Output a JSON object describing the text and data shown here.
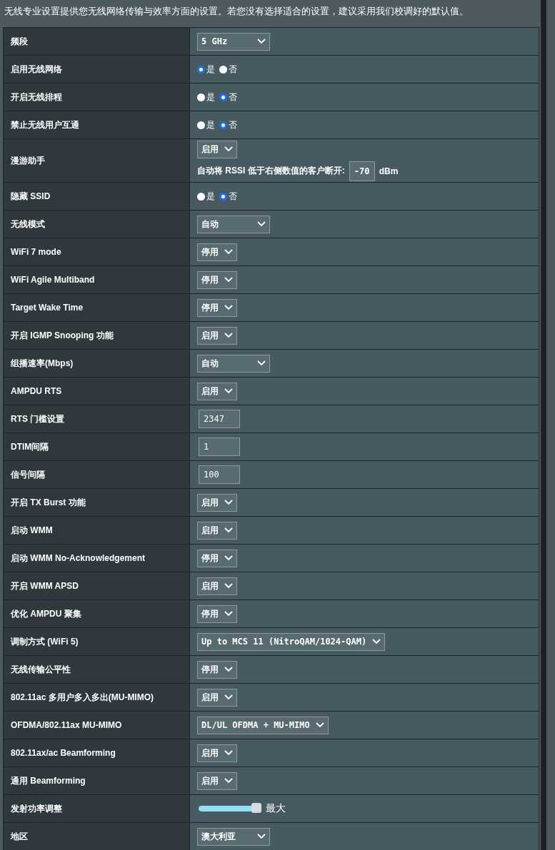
{
  "intro": "无线专业设置提供您无线网络传输与效率方面的设置。若您没有选择适合的设置，建议采用我们校调好的默认值。",
  "rows": [
    {
      "label": "频段",
      "kind": "select",
      "value": "5 GHz",
      "wide": true
    },
    {
      "label": "启用无线网络",
      "kind": "radio",
      "options": [
        {
          "label": "是",
          "selected": true
        },
        {
          "label": "否",
          "selected": false
        }
      ]
    },
    {
      "label": "开启无线排程",
      "kind": "radio",
      "options": [
        {
          "label": "是",
          "selected": false
        },
        {
          "label": "否",
          "selected": true
        }
      ]
    },
    {
      "label": "禁止无线用户互通",
      "kind": "radio",
      "options": [
        {
          "label": "是",
          "selected": false
        },
        {
          "label": "否",
          "selected": true
        }
      ]
    },
    {
      "label": "漫游助手",
      "kind": "roaming",
      "value": "启用",
      "note": "自动将 RSSI 低于右侧数值的客户断开:",
      "input": "-70",
      "unit": "dBm"
    },
    {
      "label": "隐藏 SSID",
      "kind": "radio",
      "options": [
        {
          "label": "是",
          "selected": false
        },
        {
          "label": "否",
          "selected": true
        }
      ]
    },
    {
      "label": "无线模式",
      "kind": "select",
      "value": "自动",
      "wide": true
    },
    {
      "label": "WiFi 7 mode",
      "kind": "select",
      "value": "停用"
    },
    {
      "label": "WiFi Agile Multiband",
      "kind": "select",
      "value": "停用"
    },
    {
      "label": "Target Wake Time",
      "kind": "select",
      "value": "停用"
    },
    {
      "label": "开启 IGMP Snooping 功能",
      "kind": "select",
      "value": "启用"
    },
    {
      "label": "组播速率(Mbps)",
      "kind": "select",
      "value": "自动",
      "wide": true
    },
    {
      "label": "AMPDU RTS",
      "kind": "select",
      "value": "启用"
    },
    {
      "label": "RTS 门槛设置",
      "kind": "input",
      "value": "2347"
    },
    {
      "label": "DTIM间隔",
      "kind": "input",
      "value": "1"
    },
    {
      "label": "信号间隔",
      "kind": "input",
      "value": "100"
    },
    {
      "label": "开启 TX Burst 功能",
      "kind": "select",
      "value": "启用"
    },
    {
      "label": "启动 WMM",
      "kind": "select",
      "value": "启用"
    },
    {
      "label": "启动 WMM No-Acknowledgement",
      "kind": "select",
      "value": "停用"
    },
    {
      "label": "开启 WMM APSD",
      "kind": "select",
      "value": "启用"
    },
    {
      "label": "优化 AMPDU 聚集",
      "kind": "select",
      "value": "停用"
    },
    {
      "label": "调制方式 (WiFi 5)",
      "kind": "select",
      "value": "Up to MCS 11 (NitroQAM/1024-QAM)"
    },
    {
      "label": "无线传输公平性",
      "kind": "select",
      "value": "停用"
    },
    {
      "label": "802.11ac 多用户多入多出(MU-MIMO)",
      "kind": "select",
      "value": "启用"
    },
    {
      "label": "OFDMA/802.11ax MU-MIMO",
      "kind": "select",
      "value": "DL/UL OFDMA + MU-MIMO"
    },
    {
      "label": "802.11ax/ac Beamforming",
      "kind": "select",
      "value": "启用"
    },
    {
      "label": "通用 Beamforming",
      "kind": "select",
      "value": "启用"
    },
    {
      "label": "发射功率调整",
      "kind": "slider",
      "level": 1,
      "reading": "最大"
    },
    {
      "label": "地区",
      "kind": "select",
      "value": "澳大利亚",
      "wide": true
    }
  ]
}
